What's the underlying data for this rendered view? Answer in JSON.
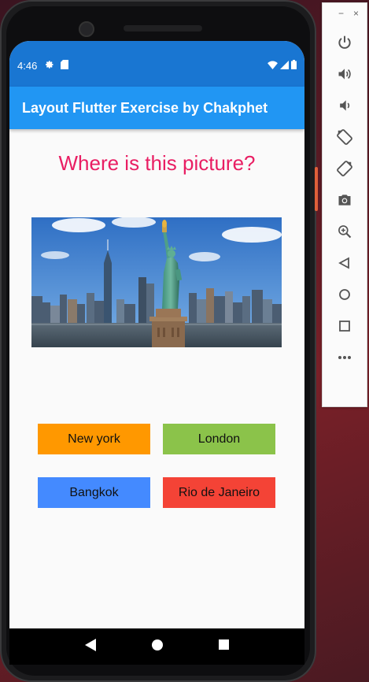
{
  "status_bar": {
    "time": "4:46",
    "left_icons": [
      "gear-icon",
      "sd-card-icon"
    ],
    "right_icons": [
      "wifi-icon",
      "signal-icon",
      "battery-icon"
    ]
  },
  "app_bar": {
    "title": "Layout Flutter Exercise by Chakphet"
  },
  "question": "Where is this picture?",
  "picture": {
    "subject": "statue-of-liberty-image"
  },
  "answers": [
    {
      "label": "New york",
      "color": "#ff9800"
    },
    {
      "label": "London",
      "color": "#8bc34a"
    },
    {
      "label": "Bangkok",
      "color": "#448aff"
    },
    {
      "label": "Rio de Janeiro",
      "color": "#f44336"
    }
  ],
  "nav_bar": {
    "icons": [
      "back-icon",
      "home-icon",
      "recents-icon"
    ]
  },
  "emulator_panel": {
    "window_controls": [
      "−",
      "×"
    ],
    "tools": [
      "power-icon",
      "volume-up-icon",
      "volume-down-icon",
      "rotate-left-icon",
      "rotate-right-icon",
      "camera-icon",
      "zoom-icon",
      "back-icon",
      "home-icon",
      "overview-icon",
      "more-icon"
    ]
  },
  "colors": {
    "status_bar": "#1976d2",
    "app_bar": "#2196f3",
    "question": "#e91e63",
    "screen_bg": "#fafafa"
  }
}
